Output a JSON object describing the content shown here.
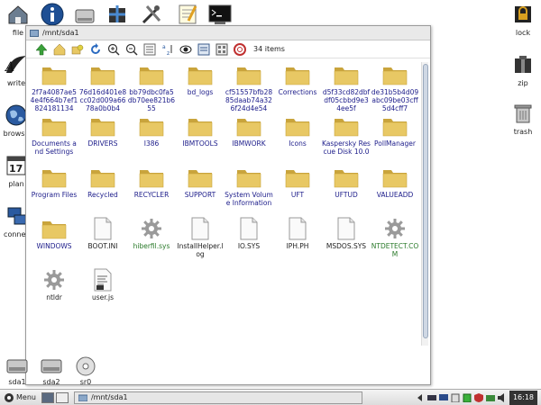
{
  "desktop_icons_left": [
    {
      "label": "file",
      "icon": "home-folder-icon"
    },
    {
      "label": "write",
      "icon": "writer-icon"
    },
    {
      "label": "browse",
      "icon": "globe-icon"
    },
    {
      "label": "plan",
      "icon": "calendar-icon"
    },
    {
      "label": "connect",
      "icon": "network-icon"
    }
  ],
  "top_icons": [
    {
      "label": "",
      "icon": "info-icon"
    },
    {
      "label": "",
      "icon": "drive-icon"
    },
    {
      "label": "",
      "icon": "package-icon"
    },
    {
      "label": "",
      "icon": "tools-icon"
    },
    {
      "label": "",
      "icon": "notepad-icon"
    },
    {
      "label": "",
      "icon": "terminal-icon"
    }
  ],
  "calendar_day": "17",
  "desktop_icons_right": [
    {
      "label": "lock",
      "icon": "lock-icon"
    },
    {
      "label": "zip",
      "icon": "zip-icon"
    },
    {
      "label": "trash",
      "icon": "trash-icon"
    }
  ],
  "window": {
    "title": "/mnt/sda1",
    "item_count": "34 items",
    "toolbar_icons": [
      "up-arrow-icon",
      "home-icon",
      "bookmark-icon",
      "refresh-icon",
      "zoom-in-icon",
      "zoom-out-icon",
      "list-view-icon",
      "sort-az-icon",
      "show-hidden-icon",
      "icon-view-icon",
      "thumbnail-view-icon",
      "help-icon"
    ]
  },
  "items": [
    {
      "name": "2f7a4087ae54e4f664b7ef1824181134",
      "type": "folder"
    },
    {
      "name": "76d16d401e8cc02d009a6678a0b0b4",
      "type": "folder"
    },
    {
      "name": "bb79dbc0fa5db70ee821b655",
      "type": "folder"
    },
    {
      "name": "bd_logs",
      "type": "folder"
    },
    {
      "name": "cf51557bfb2885daab74a326f24d4e54",
      "type": "folder"
    },
    {
      "name": "Corrections",
      "type": "folder"
    },
    {
      "name": "d5f33cd82dbfdf05cbbd9e34ee5f",
      "type": "folder"
    },
    {
      "name": "de31b5b4d09abc09be03cff5d4cff7",
      "type": "folder"
    },
    {
      "name": "Documents and Settings",
      "type": "folder"
    },
    {
      "name": "DRIVERS",
      "type": "folder"
    },
    {
      "name": "I386",
      "type": "folder"
    },
    {
      "name": "IBMTOOLS",
      "type": "folder"
    },
    {
      "name": "IBMWORK",
      "type": "folder"
    },
    {
      "name": "Icons",
      "type": "folder"
    },
    {
      "name": "Kaspersky Rescue Disk 10.0",
      "type": "folder"
    },
    {
      "name": "PollManager",
      "type": "folder"
    },
    {
      "name": "Program Files",
      "type": "folder"
    },
    {
      "name": "Recycled",
      "type": "folder"
    },
    {
      "name": "RECYCLER",
      "type": "folder"
    },
    {
      "name": "SUPPORT",
      "type": "folder"
    },
    {
      "name": "System Volume Information",
      "type": "folder"
    },
    {
      "name": "UFT",
      "type": "folder"
    },
    {
      "name": "UFTUD",
      "type": "folder"
    },
    {
      "name": "VALUEADD",
      "type": "folder"
    },
    {
      "name": "WINDOWS",
      "type": "folder"
    },
    {
      "name": "BOOT.INI",
      "type": "file"
    },
    {
      "name": "hiberfil.sys",
      "type": "exe"
    },
    {
      "name": "InstallHelper.log",
      "type": "file"
    },
    {
      "name": "IO.SYS",
      "type": "file"
    },
    {
      "name": "IPH.PH",
      "type": "file"
    },
    {
      "name": "MSDOS.SYS",
      "type": "file"
    },
    {
      "name": "NTDETECT.COM",
      "type": "exe"
    },
    {
      "name": "ntldr",
      "type": "gear"
    },
    {
      "name": "user.js",
      "type": "script"
    }
  ],
  "drives": [
    {
      "label": "sda1"
    },
    {
      "label": "sda2"
    },
    {
      "label": "sr0"
    }
  ],
  "taskbar": {
    "menu_label": "Menu",
    "task_label": "/mnt/sda1",
    "clock": "16:18"
  },
  "colors": {
    "folder": "#e8c864",
    "folder_dark": "#c9a43c",
    "link": "#1c1c8a",
    "exe": "#2a7a2a"
  }
}
